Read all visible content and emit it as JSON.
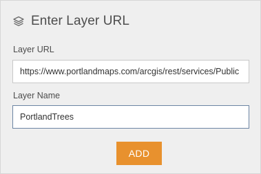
{
  "header": {
    "title": "Enter Layer URL",
    "icon": "layers-icon"
  },
  "layer_url": {
    "label": "Layer URL",
    "value": "https://www.portlandmaps.com/arcgis/rest/services/Public"
  },
  "layer_name": {
    "label": "Layer Name",
    "value": "PortlandTrees"
  },
  "add_button": {
    "label": "ADD"
  },
  "colors": {
    "panel_bg": "#efefef",
    "accent": "#e8912e",
    "focused_border": "#6b84a3"
  }
}
